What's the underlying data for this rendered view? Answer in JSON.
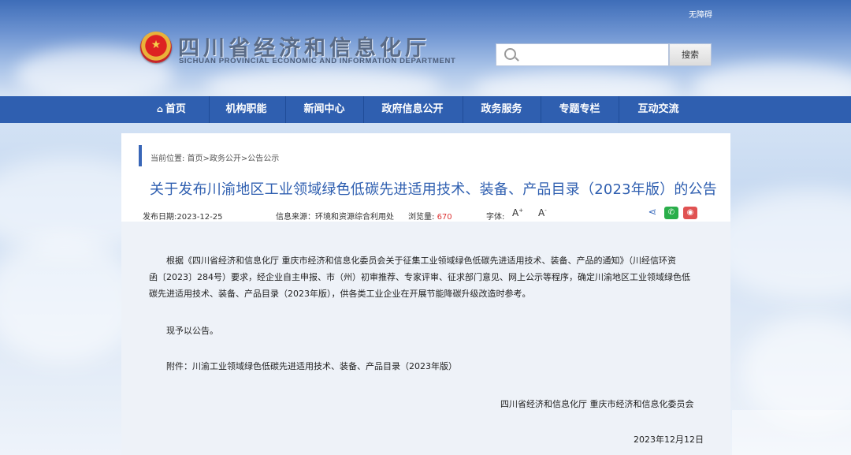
{
  "accessibility_link": "无障碍",
  "site": {
    "title": "四川省经济和信息化厅",
    "subtitle": "SICHUAN PROVINCIAL ECONOMIC AND INFORMATION DEPARTMENT"
  },
  "search": {
    "placeholder": "",
    "button_label": "搜索"
  },
  "nav": {
    "home": "首页",
    "items": [
      "机构职能",
      "新闻中心",
      "政府信息公开",
      "政务服务",
      "专题专栏",
      "互动交流"
    ]
  },
  "breadcrumb": "当前位置: 首页>政务公开>公告公示",
  "article": {
    "title": "关于发布川渝地区工业领域绿色低碳先进适用技术、装备、产品目录（2023年版）的公告",
    "publish_date": "发布日期:2023-12-25",
    "source": "信息来源：环境和资源综合利用处",
    "views_label": "浏览量:",
    "views_count": "670",
    "font_label": "字体:",
    "font_increase": "A",
    "font_decrease": "A",
    "body_1_line1": "根据《四川省经济和信息化厅 重庆市经济和信息化委员会关于征集工业领域绿色低碳先进适用技术、装备、产品的通知》（川经信环资",
    "body_1_line2": "函〔2023〕284号）要求，经企业自主申报、市（州）初审推荐、专家评审、征求部门意见、网上公示等程序，确定川渝地区工业领域绿色低",
    "body_1_line3": "碳先进适用技术、装备、产品目录（2023年版），供各类工业企业在开展节能降碳升级改造时参考。",
    "body_2": "现予以公告。",
    "attachment": "附件：川渝工业领域绿色低碳先进适用技术、装备、产品目录（2023年版）",
    "signature": "四川省经济和信息化厅   重庆市经济和信息化委员会",
    "sign_date": "2023年12月12日"
  },
  "colors": {
    "nav_bg": "#2f5fb0",
    "title": "#2f5fb0",
    "views": "#dd3333",
    "wechat": "#2aae4a",
    "weibo": "#e05252"
  }
}
